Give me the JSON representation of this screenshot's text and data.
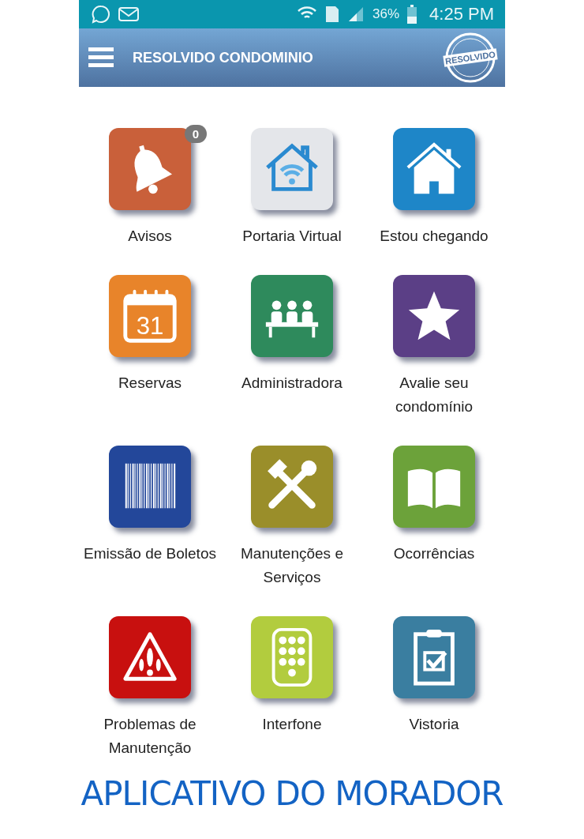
{
  "status_bar": {
    "battery": "36%",
    "time": "4:25 PM"
  },
  "app_bar": {
    "title": "RESOLVIDO CONDOMINIO",
    "logo": {
      "main": "RESOLVIDO"
    }
  },
  "tiles": [
    {
      "label": "Avisos",
      "kind": "bell",
      "color": "#c9603a",
      "badge": "0"
    },
    {
      "label": "Portaria Virtual",
      "kind": "wifi-house",
      "color": "#e4e6ea"
    },
    {
      "label": "Estou chegando",
      "kind": "house",
      "color": "#1e86c8"
    },
    {
      "label": "Reservas",
      "kind": "calendar",
      "color": "#e8842a",
      "day": "31"
    },
    {
      "label": "Administradora",
      "kind": "meeting",
      "color": "#2e8a5c"
    },
    {
      "label": "Avalie seu condomínio",
      "kind": "star",
      "color": "#5b3f86"
    },
    {
      "label": "Emissão de Boletos",
      "kind": "barcode",
      "color": "#23479a"
    },
    {
      "label": "Manutenções e Serviços",
      "kind": "tools",
      "color": "#9a8e2a"
    },
    {
      "label": "Ocorrências",
      "kind": "book",
      "color": "#6ca23a"
    },
    {
      "label": "Problemas de Manutenção",
      "kind": "warning",
      "color": "#c8100f"
    },
    {
      "label": "Interfone",
      "kind": "keypad",
      "color": "#b2cc3e"
    },
    {
      "label": "Vistoria",
      "kind": "clipboard",
      "color": "#3a7ea0"
    }
  ],
  "caption": "APLICATIVO DO MORADOR"
}
